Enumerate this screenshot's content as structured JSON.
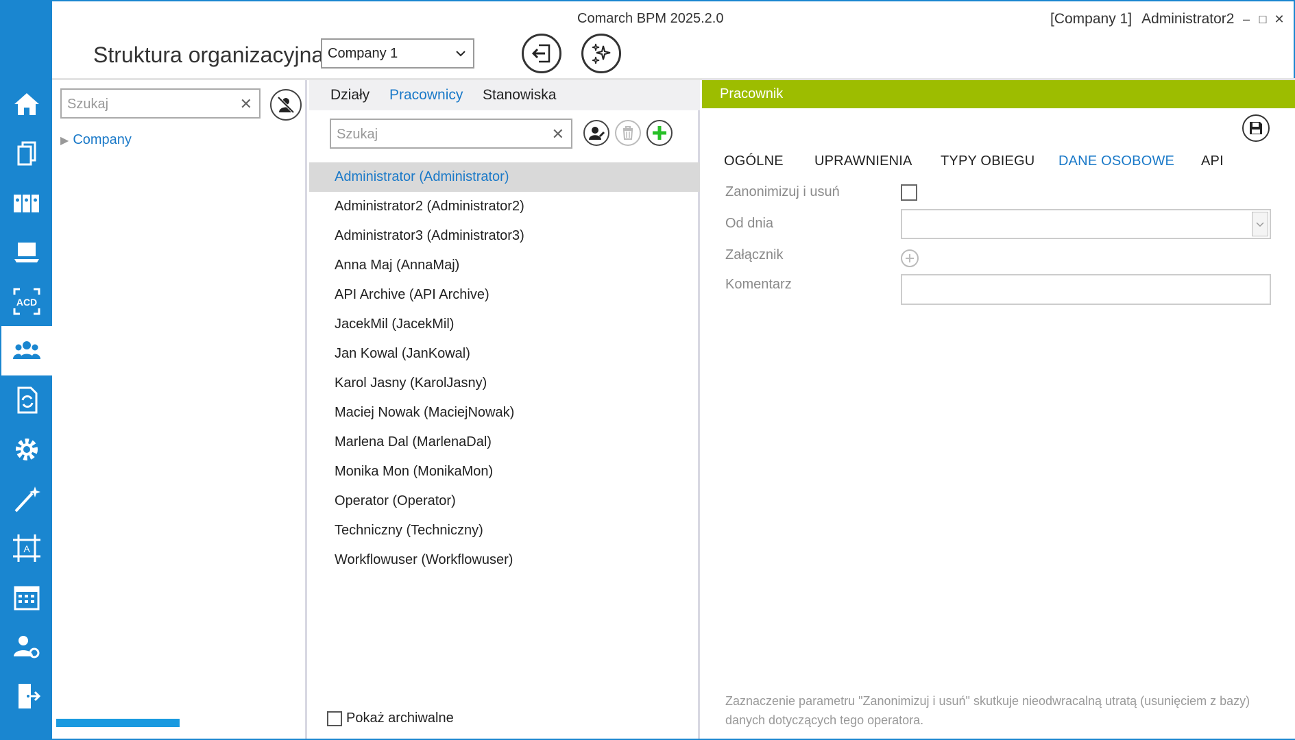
{
  "app": {
    "title": "Comarch BPM 2025.2.0",
    "company_tag": "[Company 1]",
    "user": "Administrator2",
    "controls": {
      "minimize": "–",
      "maximize": "□",
      "close": "✕"
    }
  },
  "nav": {
    "items": [
      {
        "icon": "home-icon"
      },
      {
        "icon": "documents-icon"
      },
      {
        "icon": "binders-icon"
      },
      {
        "icon": "laptop-icon"
      },
      {
        "icon": "acd-icon",
        "label": "ACD"
      },
      {
        "icon": "users-icon",
        "active": true
      },
      {
        "icon": "document-sync-icon"
      },
      {
        "icon": "settings-gear-icon"
      },
      {
        "icon": "magic-wand-icon"
      },
      {
        "icon": "form-designer-icon"
      },
      {
        "icon": "calendar-icon"
      },
      {
        "icon": "user-settings-icon"
      },
      {
        "icon": "logout-icon"
      }
    ],
    "accent": "#1a86d0"
  },
  "header": {
    "page_title": "Struktura organizacyjna",
    "company_select": "Company 1"
  },
  "tree": {
    "search_placeholder": "Szukaj",
    "root": "Company"
  },
  "employees": {
    "tabs": [
      "Działy",
      "Pracownicy",
      "Stanowiska"
    ],
    "active_tab": "Pracownicy",
    "search_placeholder": "Szukaj",
    "list": [
      "Administrator (Administrator)",
      "Administrator2 (Administrator2)",
      "Administrator3 (Administrator3)",
      "Anna Maj (AnnaMaj)",
      "API Archive (API Archive)",
      "JacekMil (JacekMil)",
      "Jan Kowal (JanKowal)",
      "Karol Jasny (KarolJasny)",
      "Maciej Nowak (MaciejNowak)",
      "Marlena Dal (MarlenaDal)",
      "Monika Mon (MonikaMon)",
      "Operator (Operator)",
      "Techniczny (Techniczny)",
      "Workflowuser (Workflowuser)"
    ],
    "selected": "Administrator (Administrator)",
    "show_archived": "Pokaż archiwalne"
  },
  "detail": {
    "header": "Pracownik",
    "header_color": "#9dbd00",
    "tabs": [
      "OGÓLNE",
      "UPRAWNIENIA",
      "TYPY OBIEGU",
      "DANE OSOBOWE",
      "API"
    ],
    "active_tab": "DANE OSOBOWE",
    "fields": {
      "anonymize": "Zanonimizuj i usuń",
      "from_date": "Od dnia",
      "attachment": "Załącznik",
      "comment": "Komentarz"
    },
    "note": "Zaznaczenie parametru \"Zanonimizuj i usuń\" skutkuje nieodwracalną utratą (usunięciem z bazy) danych dotyczących tego operatora."
  }
}
